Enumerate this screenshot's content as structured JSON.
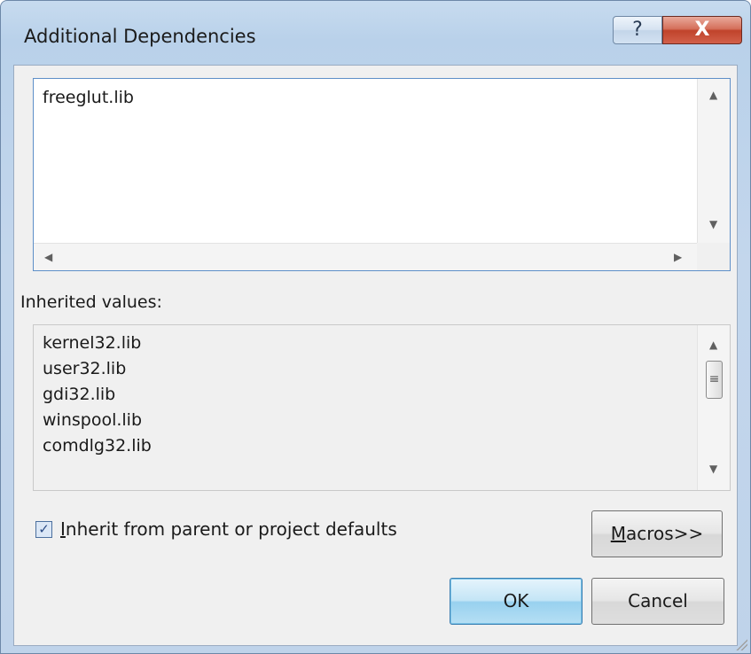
{
  "window": {
    "title": "Additional Dependencies",
    "help_glyph": "?",
    "close_glyph": "X"
  },
  "edit": {
    "value": "freeglut.lib"
  },
  "inherited": {
    "label": "Inherited values:",
    "items": [
      "kernel32.lib",
      "user32.lib",
      "gdi32.lib",
      "winspool.lib",
      "comdlg32.lib"
    ]
  },
  "inherit_checkbox": {
    "label": "Inherit from parent or project defaults",
    "checked": true
  },
  "buttons": {
    "macros": "Macros>>",
    "ok": "OK",
    "cancel": "Cancel"
  },
  "icons": {
    "up": "scroll-up-arrow-icon",
    "down": "scroll-down-arrow-icon",
    "left": "scroll-left-arrow-icon",
    "right": "scroll-right-arrow-icon",
    "close": "close-icon",
    "help": "help-icon",
    "grip": "resize-grip-icon"
  }
}
